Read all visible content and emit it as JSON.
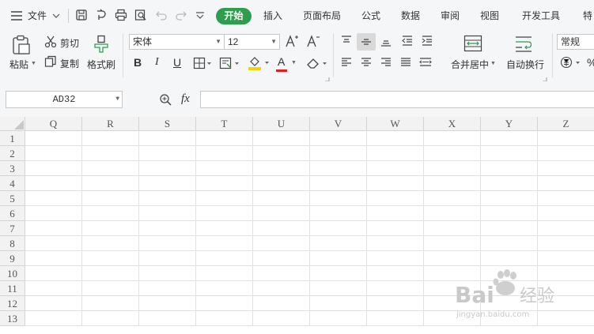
{
  "menubar": {
    "file_label": "文件",
    "tabs": [
      "开始",
      "插入",
      "页面布局",
      "公式",
      "数据",
      "审阅",
      "视图",
      "开发工具",
      "特"
    ]
  },
  "ribbon": {
    "paste": "粘贴",
    "cut": "剪切",
    "copy": "复制",
    "format_painter": "格式刷",
    "font_name": "宋体",
    "font_size": "12",
    "merge_center": "合并居中",
    "wrap_text": "自动换行",
    "number_format": "常规",
    "bold": "B",
    "italic": "I",
    "underline": "U",
    "font_color_letter": "A"
  },
  "formula_bar": {
    "name_box": "AD32",
    "fx": "fx",
    "value": ""
  },
  "sheet": {
    "columns": [
      "Q",
      "R",
      "S",
      "T",
      "U",
      "V",
      "W",
      "X",
      "Y",
      "Z"
    ],
    "rows": [
      "1",
      "2",
      "3",
      "4",
      "5",
      "6",
      "7",
      "8",
      "9",
      "10",
      "11",
      "12",
      "13"
    ]
  },
  "watermark": {
    "logo": "Bai 经验",
    "url": "jingyan.baidu.com"
  },
  "colors": {
    "accent": "#2e9d4e",
    "toolbar_bg": "#f5f6f7",
    "header_bg": "#f2f2f2"
  }
}
